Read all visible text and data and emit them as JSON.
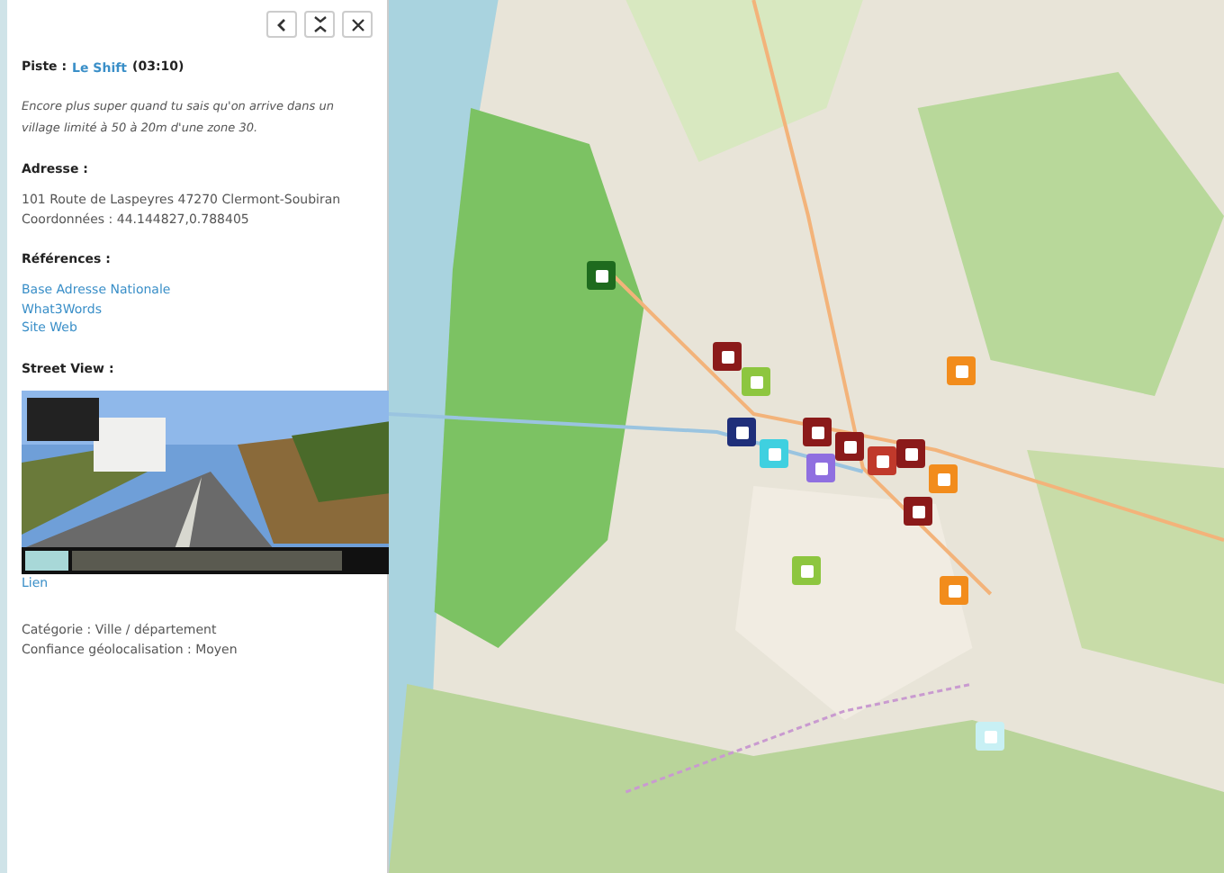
{
  "panel": {
    "buttons": [
      {
        "kind": "back"
      },
      {
        "kind": "collapse"
      },
      {
        "kind": "close"
      }
    ],
    "track": {
      "label": "Piste :",
      "link": "Le Shift",
      "duration": "(03:10)"
    },
    "comment": "Encore plus super quand tu sais qu'on arrive dans un village limité à 50 à 20m d'une zone 30.",
    "address": {
      "heading": "Adresse :",
      "lines": [
        "101 Route de Laspeyres 47270 Clermont-Soubiran",
        "Coordonnées : 44.144827,0.788405"
      ]
    },
    "references": {
      "heading": "Références :",
      "links": [
        "Base Adresse Nationale",
        "What3Words",
        "Site Web"
      ]
    },
    "street_view": {
      "heading": "Street View :",
      "kind": "picture",
      "link": "Lien"
    },
    "details": [
      "Catégorie : Ville / département",
      "Confiance géolocalisation : Moyen"
    ]
  },
  "map": {
    "kind": "picture",
    "markers": [
      {
        "color": "#1e6b1e"
      },
      {
        "color": "#8b1a1a"
      },
      {
        "color": "#8dc63f"
      },
      {
        "color": "#f28c1c"
      },
      {
        "color": "#1f2f7a"
      },
      {
        "color": "#3fd0e0"
      },
      {
        "color": "#8b1a1a"
      },
      {
        "color": "#8b1a1a"
      },
      {
        "color": "#8f6fe0"
      },
      {
        "color": "#c0392b"
      },
      {
        "color": "#8b1a1a"
      },
      {
        "color": "#f28c1c"
      },
      {
        "color": "#8b1a1a"
      },
      {
        "color": "#8dc63f"
      },
      {
        "color": "#f28c1c"
      },
      {
        "color": "#c8f0f4"
      }
    ]
  }
}
